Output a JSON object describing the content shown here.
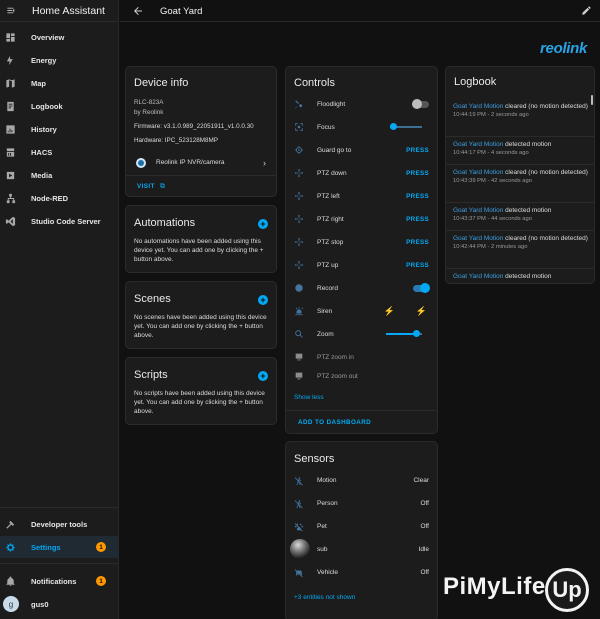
{
  "app": {
    "title": "Home Assistant"
  },
  "sidebar": {
    "items": [
      {
        "label": "Overview"
      },
      {
        "label": "Energy"
      },
      {
        "label": "Map"
      },
      {
        "label": "Logbook"
      },
      {
        "label": "History"
      },
      {
        "label": "HACS"
      },
      {
        "label": "Media"
      },
      {
        "label": "Node-RED"
      },
      {
        "label": "Studio Code Server"
      }
    ],
    "developer_tools": "Developer tools",
    "settings": "Settings",
    "settings_badge": "1",
    "notifications": "Notifications",
    "notifications_badge": "1",
    "user_initial": "g",
    "user_name": "gus0"
  },
  "header": {
    "title": "Goat Yard"
  },
  "brand": {
    "text": "reolink"
  },
  "device_info": {
    "title": "Device info",
    "model": "RLC-823A",
    "manufacturer": "by Reolink",
    "firmware": "Firmware: v3.1.0.989_22051911_v1.0.0.30",
    "hardware": "Hardware: IPC_523128M8MP",
    "via": "Reolink IP NVR/camera",
    "visit": "VISIT"
  },
  "automations": {
    "title": "Automations",
    "text": "No automations have been added using this device yet. You can add one by clicking the + button above."
  },
  "scenes": {
    "title": "Scenes",
    "text": "No scenes have been added using this device yet. You can add one by clicking the + button above."
  },
  "scripts": {
    "title": "Scripts",
    "text": "No scripts have been added using this device yet. You can add one by clicking the + button above."
  },
  "controls": {
    "title": "Controls",
    "rows": [
      {
        "name": "Floodlight",
        "kind": "toggle-off"
      },
      {
        "name": "Focus",
        "kind": "slider",
        "level": 0.12
      },
      {
        "name": "Guard go to",
        "kind": "press",
        "action": "PRESS"
      },
      {
        "name": "PTZ down",
        "kind": "press",
        "action": "PRESS"
      },
      {
        "name": "PTZ left",
        "kind": "press",
        "action": "PRESS"
      },
      {
        "name": "PTZ right",
        "kind": "press",
        "action": "PRESS"
      },
      {
        "name": "PTZ stop",
        "kind": "press",
        "action": "PRESS"
      },
      {
        "name": "PTZ up",
        "kind": "press",
        "action": "PRESS"
      },
      {
        "name": "Record",
        "kind": "toggle-on"
      },
      {
        "name": "Siren",
        "kind": "siren"
      },
      {
        "name": "Zoom",
        "kind": "slider",
        "level": 0.85
      },
      {
        "name": "PTZ zoom in",
        "kind": "dim"
      },
      {
        "name": "PTZ zoom out",
        "kind": "dim"
      }
    ],
    "show_less": "Show less",
    "add_to_dashboard": "ADD TO DASHBOARD"
  },
  "sensors": {
    "title": "Sensors",
    "rows": [
      {
        "name": "Motion",
        "value": "Clear"
      },
      {
        "name": "Person",
        "value": "Off"
      },
      {
        "name": "Pet",
        "value": "Off"
      },
      {
        "name": "sub",
        "value": "Idle"
      },
      {
        "name": "Vehicle",
        "value": "Off"
      }
    ],
    "more": "+3 entities not shown"
  },
  "logbook": {
    "title": "Logbook",
    "entries": [
      {
        "entity": "Goat Yard Motion",
        "text": " cleared (no motion detected)",
        "time": "10:44:19 PM - 2 seconds ago"
      },
      {
        "entity": "Goat Yard Motion",
        "text": " detected motion",
        "time": "10:44:17 PM - 4 seconds ago"
      },
      {
        "entity": "Goat Yard Motion",
        "text": " cleared (no motion detected)",
        "time": "10:43:39 PM - 42 seconds ago"
      },
      {
        "entity": "Goat Yard Motion",
        "text": " detected motion",
        "time": "10:43:37 PM - 44 seconds ago"
      },
      {
        "entity": "Goat Yard Motion",
        "text": " cleared (no motion detected)",
        "time": "10:42:44 PM - 2 minutes ago"
      },
      {
        "entity": "Goat Yard Motion",
        "text": " detected motion",
        "time": ""
      }
    ]
  },
  "watermark": {
    "text": "PiMyLife",
    "badge": "Up"
  }
}
